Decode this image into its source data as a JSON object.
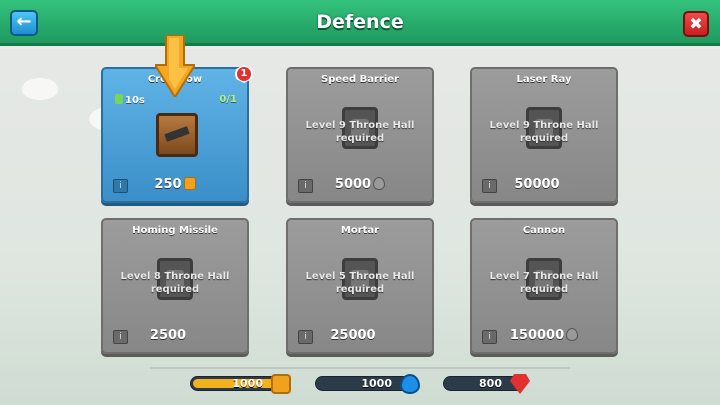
{
  "header": {
    "title": "Defence",
    "back_icon": "back-arrow-icon",
    "close_icon": "close-x-icon"
  },
  "cards": [
    {
      "name": "Crossbow",
      "active": true,
      "timer": "10s",
      "count": "0/1",
      "cost": "250",
      "resource": "gold",
      "badge": "1"
    },
    {
      "name": "Speed Barrier",
      "requirement": "Level 9 Throne Hall required",
      "cost": "5000",
      "resource": "oil"
    },
    {
      "name": "Laser Ray",
      "requirement": "Level 9 Throne Hall required",
      "cost": "50000",
      "resource": "gem"
    },
    {
      "name": "Homing Missile",
      "requirement": "Level 8 Throne Hall required",
      "cost": "2500",
      "resource": "gem"
    },
    {
      "name": "Mortar",
      "requirement": "Level 5 Throne Hall required",
      "cost": "25000",
      "resource": "gem"
    },
    {
      "name": "Cannon",
      "requirement": "Level 7 Throne Hall required",
      "cost": "150000",
      "resource": "oil"
    }
  ],
  "resources": {
    "gold": {
      "value": "1000",
      "fill": 0.95,
      "color": "#f2b21e"
    },
    "oil": {
      "value": "1000",
      "fill": 0.0,
      "color": "#1d8fe8"
    },
    "gems": {
      "value": "800",
      "fill": 0.0,
      "color": "#e23030"
    }
  }
}
